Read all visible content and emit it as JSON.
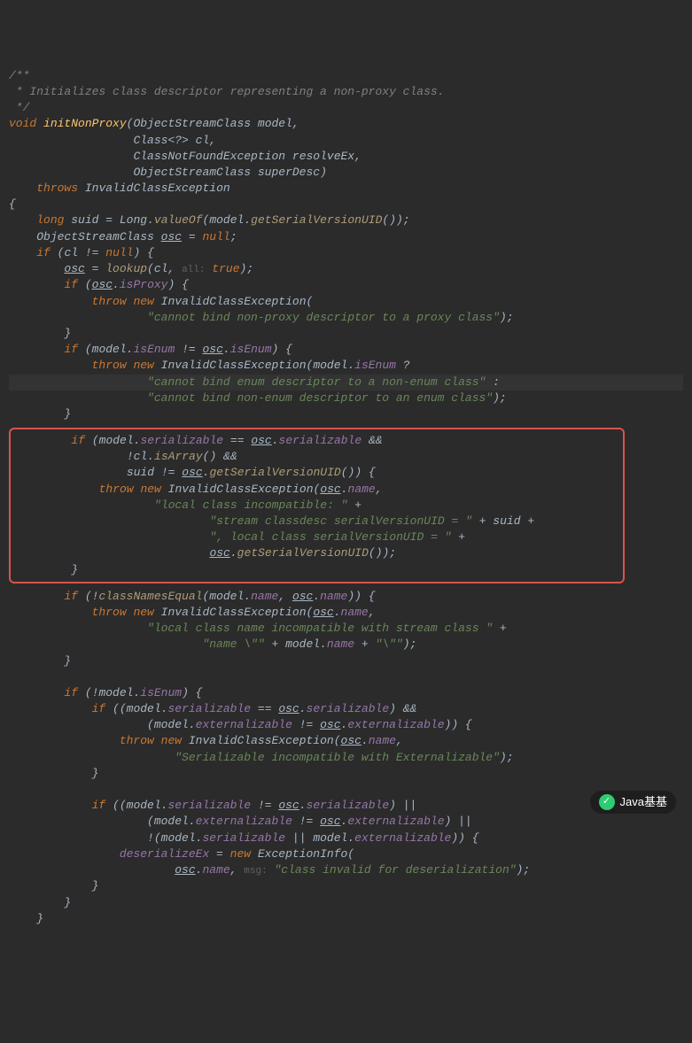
{
  "comment": {
    "l1": "/**",
    "l2": " * Initializes class descriptor representing a non-proxy class.",
    "l3": " */"
  },
  "sig": {
    "kw_void": "void",
    "name": "initNonProxy",
    "p1_type": "ObjectStreamClass",
    "p1_name": "model",
    "p2_type": "Class<?>",
    "p2_name": "cl",
    "p3_type": "ClassNotFoundException",
    "p3_name": "resolveEx",
    "p4_type": "ObjectStreamClass",
    "p4_name": "superDesc",
    "throws_kw": "throws",
    "throws_type": "InvalidClassException"
  },
  "b": {
    "long_kw": "long",
    "suid": "suid",
    "eq": " = ",
    "Long": "Long",
    "valueOf": "valueOf",
    "model": "model",
    "getSVUID": "getSerialVersionUID",
    "osc_decl_type": "ObjectStreamClass",
    "osc": "osc",
    "null_kw": "null",
    "if_kw": "if",
    "cl": "cl",
    "ne": " != ",
    "lookup": "lookup",
    "hint_all": "all:",
    "true_kw": "true",
    "isProxy": "isProxy",
    "throw_kw": "throw",
    "new_kw": "new",
    "ICE": "InvalidClassException",
    "s_proxy": "\"cannot bind non-proxy descriptor to a proxy class\"",
    "isEnum": "isEnum",
    "s_enum1": "\"cannot bind enum descriptor to a non-enum class\"",
    "s_enum2": "\"cannot bind non-enum descriptor to an enum class\"",
    "serializable": "serializable",
    "isArray": "isArray",
    "name": "name",
    "s_local_incompat": "\"local class incompatible: \"",
    "s_stream_suid": "\"stream classdesc serialVersionUID = \"",
    "s_local_suid": "\", local class serialVersionUID = \"",
    "classNamesEqual": "classNamesEqual",
    "s_local_name": "\"local class name incompatible with stream class \"",
    "s_name_q1": "\"name \\\"\"",
    "s_name_q2": "\"\\\"\"",
    "externalizable": "externalizable",
    "s_ext": "\"Serializable incompatible with Externalizable\"",
    "deserializeEx": "deserializeEx",
    "ExceptionInfo": "ExceptionInfo",
    "hint_msg": "msg:",
    "s_invalid": "\"class invalid for deserialization\""
  },
  "watermark": {
    "text": "Java基基",
    "icon": "✓"
  }
}
